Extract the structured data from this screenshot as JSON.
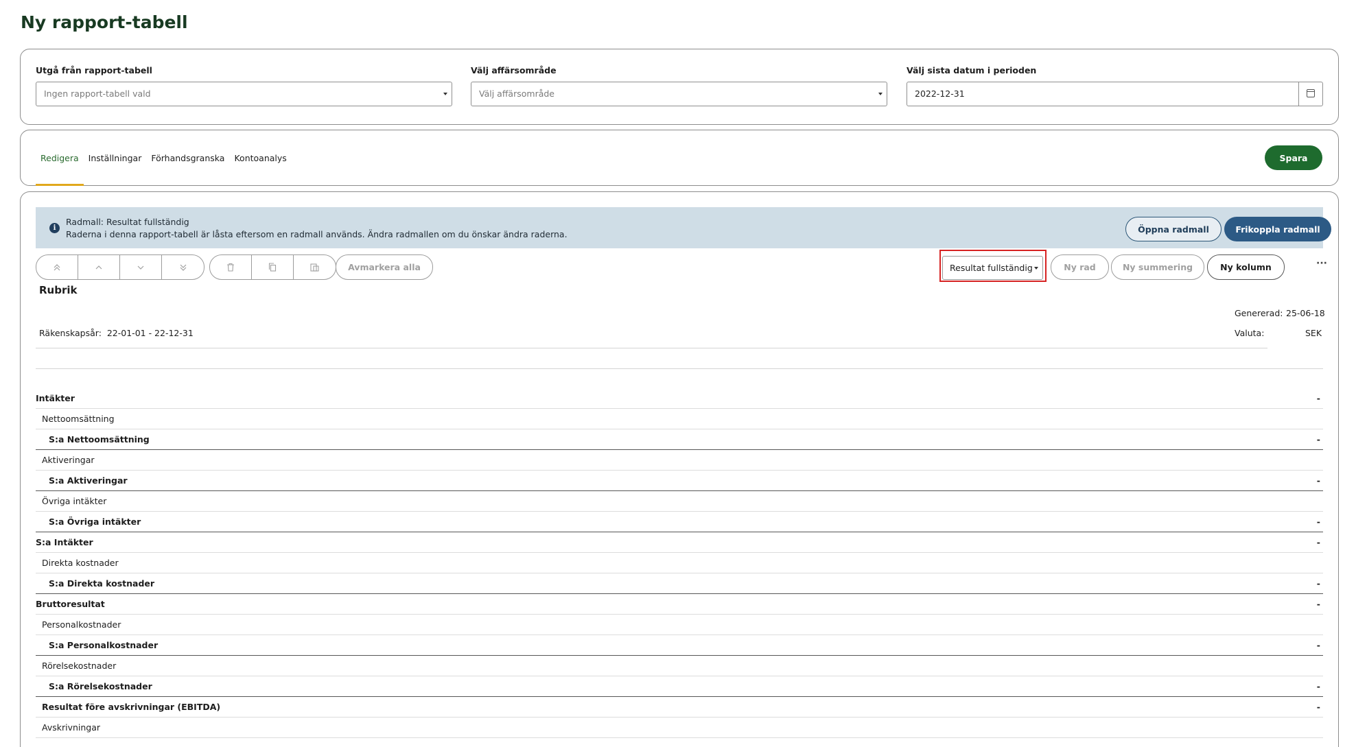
{
  "page": {
    "title": "Ny rapport-tabell"
  },
  "filters": {
    "source": {
      "label": "Utgå från rapport-tabell",
      "placeholder": "Ingen rapport-tabell vald"
    },
    "area": {
      "label": "Välj affärsområde",
      "placeholder": "Välj affärsområde"
    },
    "date": {
      "label": "Välj sista datum i perioden",
      "value": "2022-12-31",
      "icon": "calendar-icon"
    }
  },
  "tabs": [
    {
      "label": "Redigera",
      "active": true
    },
    {
      "label": "Inställningar",
      "active": false
    },
    {
      "label": "Förhandsgranska",
      "active": false
    },
    {
      "label": "Kontoanalys",
      "active": false
    }
  ],
  "save_label": "Spara",
  "info": {
    "title": "Radmall: Resultat fullständig",
    "text": "Raderna i denna rapport-tabell är låsta eftersom en radmall används. Ändra radmallen om du önskar ändra raderna.",
    "open_label": "Öppna radmall",
    "detach_label": "Frikoppla radmall"
  },
  "toolbar": {
    "icons": [
      "move-top-icon",
      "move-up-icon",
      "move-down-icon",
      "move-bottom-icon",
      "delete-icon",
      "copy-icon",
      "paste-icon"
    ],
    "deselect_label": "Avmarkera alla",
    "template_select": "Resultat fullständig",
    "new_row": "Ny rad",
    "new_sum": "Ny summering",
    "new_col": "Ny kolumn",
    "more": "···"
  },
  "report": {
    "heading": "Rubrik",
    "fiscal_label": "Räkenskapsår:",
    "fiscal_value": "22-01-01 - 22-12-31",
    "generated_label": "Genererad:",
    "generated_value": "25-06-18",
    "currency_label": "Valuta:",
    "currency_value": "SEK"
  },
  "rows": [
    {
      "label": "Intäkter",
      "type": "head",
      "level": 0,
      "value": "-"
    },
    {
      "label": "Nettoomsättning",
      "type": "item",
      "level": 1,
      "value": ""
    },
    {
      "label": "S:a Nettoomsättning",
      "type": "sum",
      "level": 2,
      "value": "-"
    },
    {
      "label": "Aktiveringar",
      "type": "item",
      "level": 1,
      "value": ""
    },
    {
      "label": "S:a Aktiveringar",
      "type": "sum",
      "level": 2,
      "value": "-"
    },
    {
      "label": "Övriga intäkter",
      "type": "item",
      "level": 1,
      "value": ""
    },
    {
      "label": "S:a Övriga intäkter",
      "type": "sum",
      "level": 2,
      "value": "-"
    },
    {
      "label": "S:a Intäkter",
      "type": "head",
      "level": 0,
      "value": "-"
    },
    {
      "label": "Direkta kostnader",
      "type": "item",
      "level": 1,
      "value": ""
    },
    {
      "label": "S:a Direkta kostnader",
      "type": "sum",
      "level": 2,
      "value": "-"
    },
    {
      "label": "Bruttoresultat",
      "type": "head",
      "level": 0,
      "value": "-"
    },
    {
      "label": "Personalkostnader",
      "type": "item",
      "level": 1,
      "value": ""
    },
    {
      "label": "S:a Personalkostnader",
      "type": "sum",
      "level": 2,
      "value": "-"
    },
    {
      "label": "Rörelsekostnader",
      "type": "item",
      "level": 1,
      "value": ""
    },
    {
      "label": "S:a Rörelsekostnader",
      "type": "sum",
      "level": 2,
      "value": "-"
    },
    {
      "label": "Resultat före avskrivningar (EBITDA)",
      "type": "head",
      "level": 1,
      "value": "-"
    },
    {
      "label": "Avskrivningar",
      "type": "item",
      "level": 1,
      "value": ""
    }
  ],
  "colors": {
    "accent_green": "#1e6b2e",
    "tab_underline": "#e0a81c",
    "info_bg": "#cfdde6",
    "highlight": "#d62222"
  }
}
